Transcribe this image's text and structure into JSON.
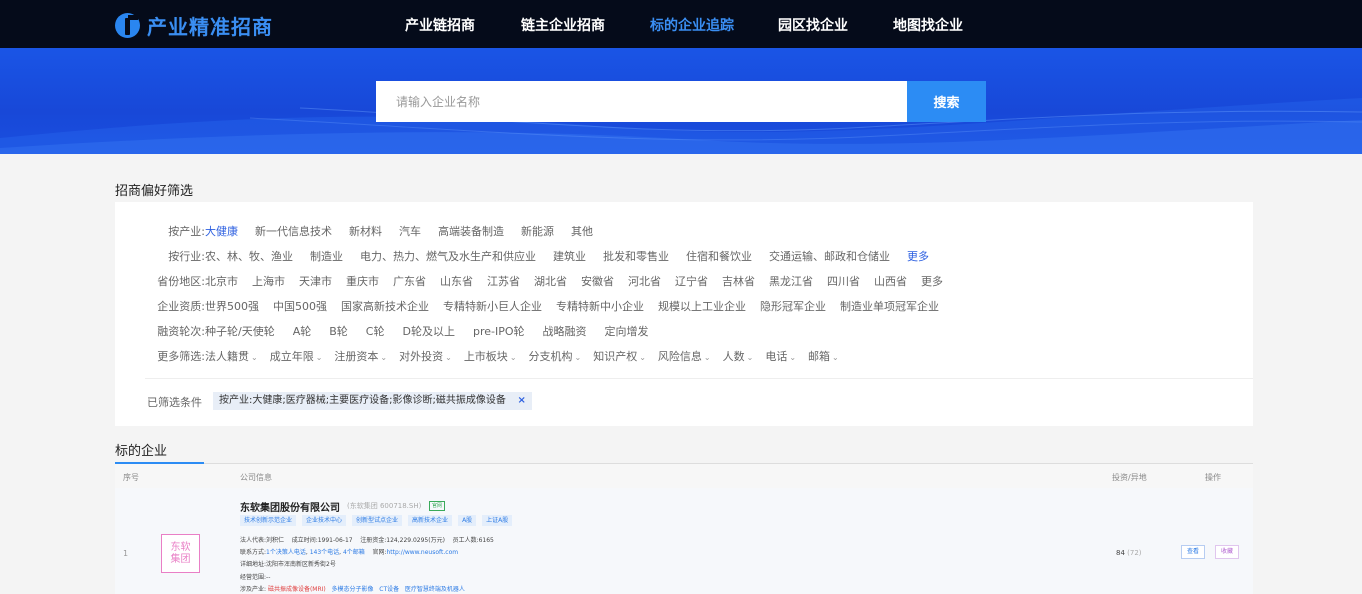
{
  "header": {
    "logo_text": "产业精准招商",
    "nav": [
      "产业链招商",
      "链主企业招商",
      "标的企业追踪",
      "园区找企业",
      "地图找企业"
    ],
    "active_nav_index": 2
  },
  "search": {
    "placeholder": "请输入企业名称",
    "button_label": "搜索"
  },
  "filters": {
    "section_title": "招商偏好筛选",
    "rows": [
      {
        "label": "按产业:",
        "options": [
          "大健康",
          "新一代信息技术",
          "新材料",
          "汽车",
          "高端装备制造",
          "新能源",
          "其他"
        ],
        "active": "大健康"
      },
      {
        "label": "按行业:",
        "options": [
          "农、林、牧、渔业",
          "制造业",
          "电力、热力、燃气及水生产和供应业",
          "建筑业",
          "批发和零售业",
          "住宿和餐饮业",
          "交通运输、邮政和仓储业"
        ],
        "more": "更多"
      },
      {
        "label": "省份地区:",
        "options": [
          "北京市",
          "上海市",
          "天津市",
          "重庆市",
          "广东省",
          "山东省",
          "江苏省",
          "湖北省",
          "安徽省",
          "河北省",
          "辽宁省",
          "吉林省",
          "黑龙江省",
          "四川省",
          "山西省"
        ],
        "more_plain": "更多"
      },
      {
        "label": "企业资质:",
        "options": [
          "世界500强",
          "中国500强",
          "国家高新技术企业",
          "专精特新小巨人企业",
          "专精特新中小企业",
          "规模以上工业企业",
          "隐形冠军企业",
          "制造业单项冠军企业"
        ]
      },
      {
        "label": "融资轮次:",
        "options": [
          "种子轮/天使轮",
          "A轮",
          "B轮",
          "C轮",
          "D轮及以上",
          "pre-IPO轮",
          "战略融资",
          "定向增发"
        ]
      },
      {
        "label": "更多筛选:",
        "dropdowns": [
          "法人籍贯",
          "成立年限",
          "注册资本",
          "对外投资",
          "上市板块",
          "分支机构",
          "知识产权",
          "风险信息",
          "人数",
          "电话",
          "邮箱"
        ]
      }
    ],
    "selected_label": "已筛选条件",
    "selected_value": "按产业:大健康;医疗器械;主要医疗设备;影像诊断;磁共振成像设备",
    "close_glyph": "×"
  },
  "companies": {
    "section_title": "标的企业",
    "columns": [
      "序号",
      "公司信息",
      "投资/异地",
      "操作"
    ],
    "rows": [
      {
        "index": "1",
        "logo_text": "东软\n集团",
        "name": "东软集团股份有限公司",
        "code": "(东软集团 600718.SH)",
        "listed_badge": "官网",
        "tags": [
          "技术创新示范企业",
          "企业技术中心",
          "创新型试点企业",
          "高新技术企业",
          "A股",
          "上证A股"
        ],
        "legal_rep_label": "法人代表:",
        "legal_rep": "刘积仁",
        "founded_label": "成立时间:",
        "founded": "1991-06-17",
        "capital_label": "注册资金:",
        "capital": "124,229.0295(万元)",
        "staff_label": "员工人数:",
        "staff": "6165",
        "contact_label": "联系方式:",
        "contact_1": "1个决策人电话",
        "contact_2": "143个电话",
        "contact_3": "4个邮箱",
        "site_label": "官网:",
        "site": "http://www.neusoft.com",
        "address_label": "详细地址:",
        "address": "沈阳市浑南新区新秀街2号",
        "scope_label": "经营范围:",
        "scope": "--",
        "industry_label": "涉及产业:",
        "industry_hl": "磁共振成像设备(MRI)",
        "industry_rest": [
          "多模态分子影像",
          "CT设备",
          "医疗智慧终端及机器人"
        ],
        "invest": "84",
        "invest_sub": "(72)",
        "action_view": "查看",
        "action_fav": "收藏"
      }
    ]
  },
  "colors": {
    "nav_bg": "#050b1a",
    "accent": "#2c8cf4",
    "banner": "#1a55e6",
    "active_filter": "#2c5fe0"
  }
}
